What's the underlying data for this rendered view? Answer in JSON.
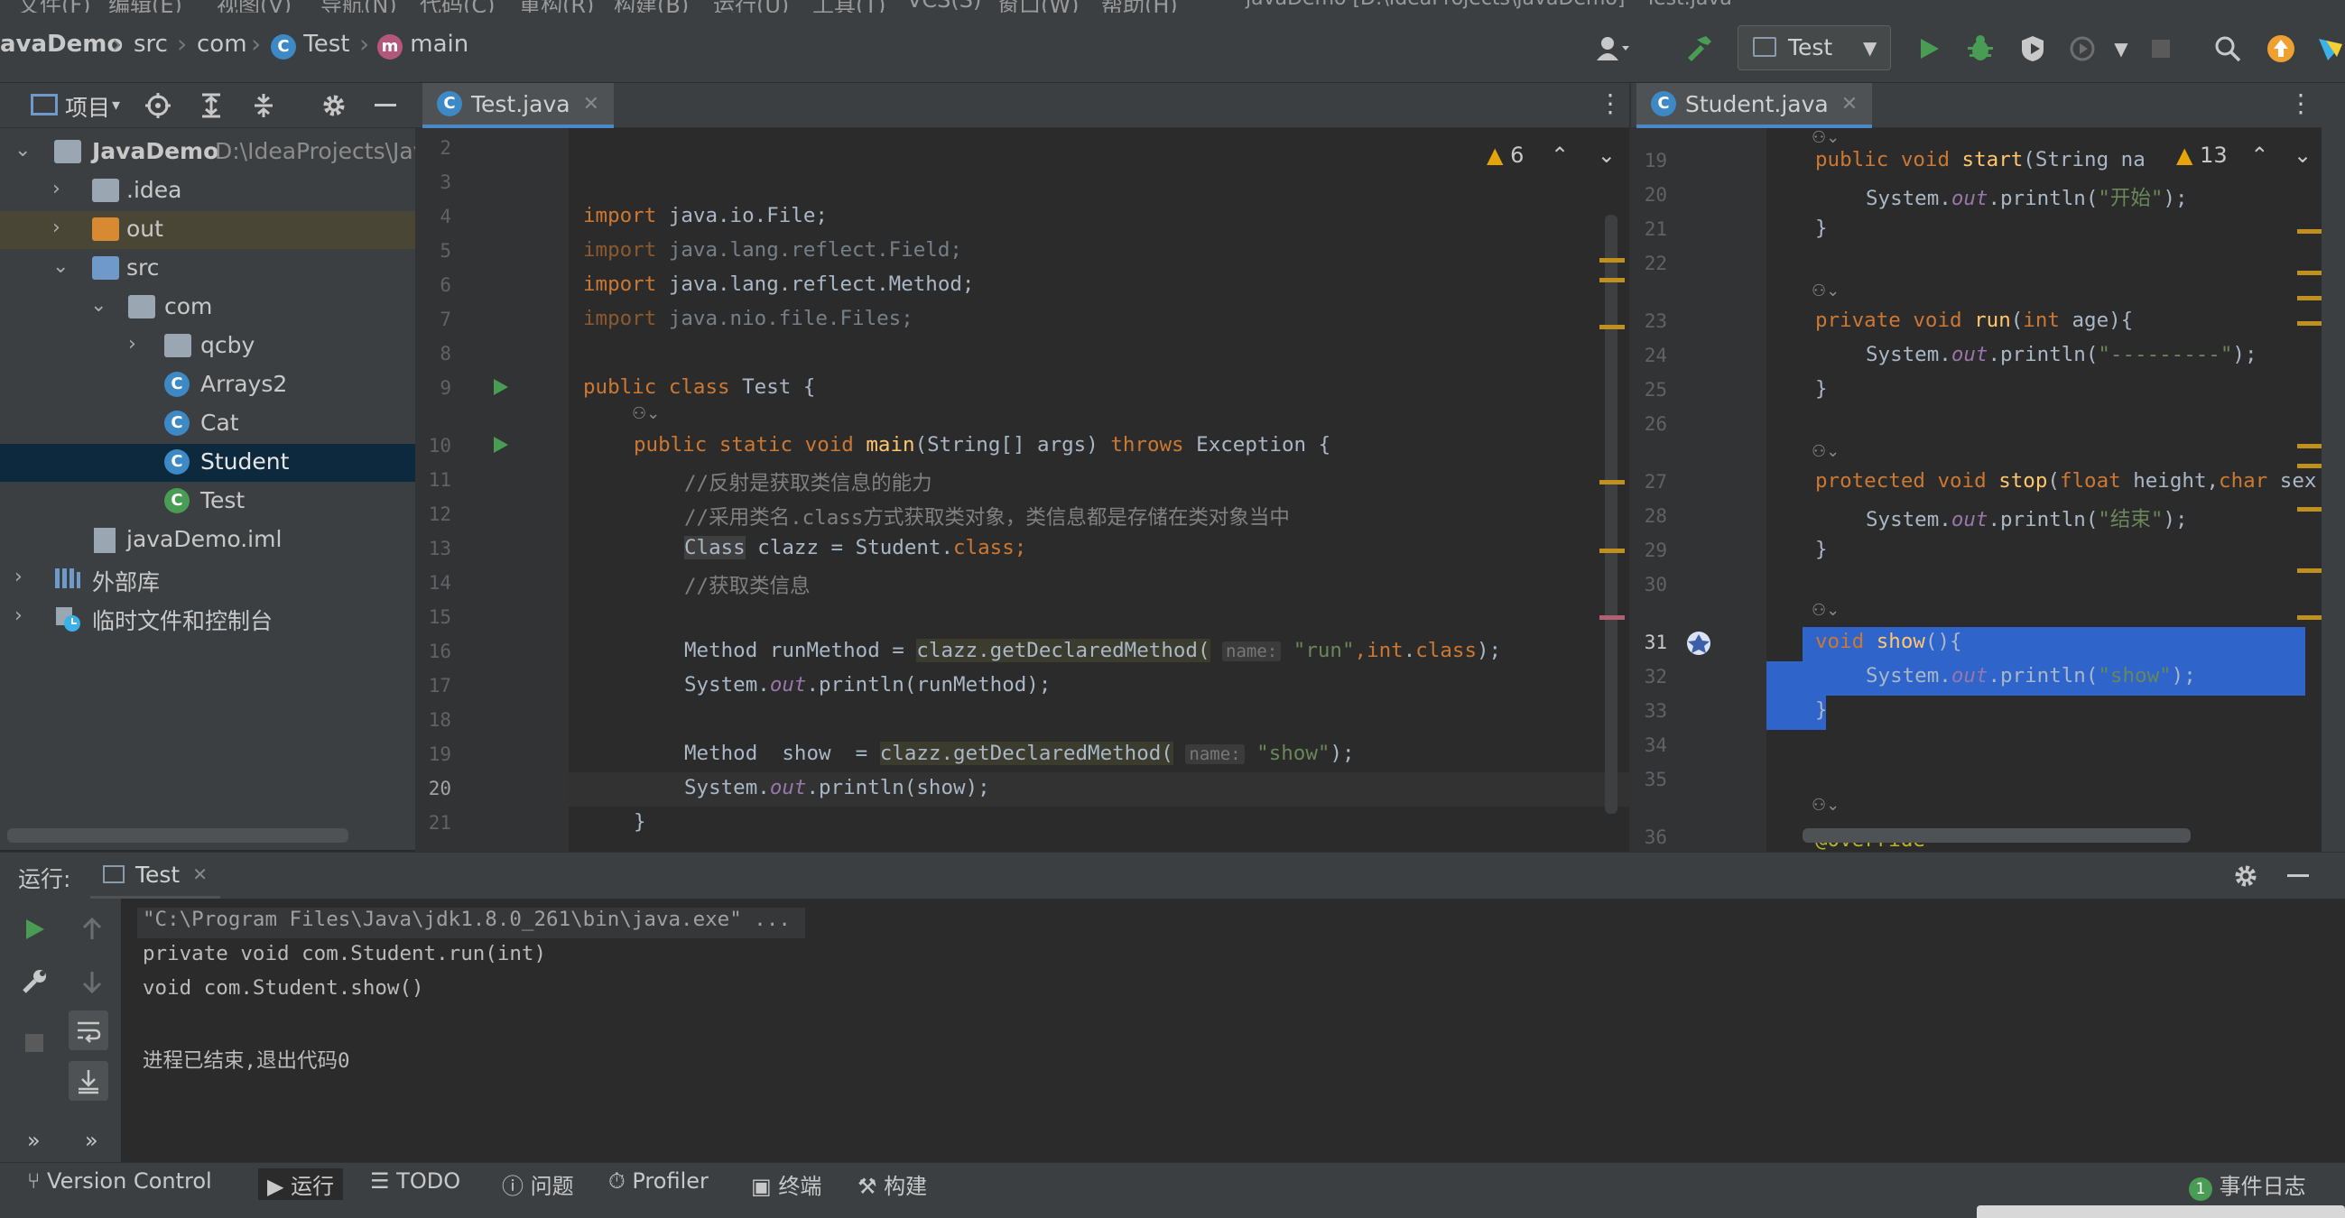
{
  "menubar": {
    "items": [
      "文件(F)",
      "编辑(E)",
      "视图(V)",
      "导航(N)",
      "代码(C)",
      "重构(R)",
      "构建(B)",
      "运行(U)",
      "工具(T)",
      "VCS(S)",
      "窗口(W)",
      "帮助(H)"
    ],
    "window_title": "javaDemo [D:\\IdeaProjects\\javaDemo] - Test.java"
  },
  "breadcrumb": {
    "project": "avaDemo",
    "src": "src",
    "com": "com",
    "class": "Test",
    "method": "main"
  },
  "toolbar": {
    "run_config": "Test"
  },
  "project_panel": {
    "title": "项目",
    "tree": [
      {
        "label": "JavaDemo",
        "path": "D:\\IdeaProjects\\Java"
      },
      {
        "label": ".idea"
      },
      {
        "label": "out"
      },
      {
        "label": "src"
      },
      {
        "label": "com"
      },
      {
        "label": "qcby"
      },
      {
        "label": "Arrays2"
      },
      {
        "label": "Cat"
      },
      {
        "label": "Student"
      },
      {
        "label": "Test"
      },
      {
        "label": "javaDemo.iml"
      },
      {
        "label": "外部库"
      },
      {
        "label": "临时文件和控制台"
      }
    ]
  },
  "left_editor": {
    "tab": "Test.java",
    "warnings": "6",
    "line_numbers": [
      "2",
      "3",
      "4",
      "5",
      "6",
      "7",
      "8",
      "9",
      "10",
      "11",
      "12",
      "13",
      "14",
      "15",
      "16",
      "17",
      "18",
      "19",
      "20",
      "21"
    ],
    "code": {
      "l4_kw": "import",
      "l4_rest": " java.io.File;",
      "l5_kw": "import",
      "l5_rest": " java.lang.reflect.Field;",
      "l6_kw": "import",
      "l6_rest": " java.lang.reflect.Method;",
      "l7_kw": "import",
      "l7_rest": " java.nio.file.Files;",
      "l9_kw": "public class",
      "l9_rest": " Test {",
      "l10_kw": "public static void",
      "l10_fn": " main",
      "l10_rest": "(String[] args) ",
      "l10_kw2": "throws",
      "l10_rest2": " Exception {",
      "l11": "//反射是获取类信息的能力",
      "l12": "//采用类名.class方式获取类对象，类信息都是存储在类对象当中",
      "l13_a": "Class",
      "l13_b": " clazz = Student.",
      "l13_kw": "class",
      "l13_c": ";",
      "l14": "//获取类信息",
      "l16_a": "Method runMethod = ",
      "l16_b": "clazz.getDeclaredMethod(",
      "l16_hint": "name:",
      "l16_str": " \"run\"",
      "l16_c": ",",
      "l16_kw": "int",
      "l16_d": ".",
      "l16_kw2": "class",
      "l16_e": ");",
      "l17_a": "System.",
      "l17_fld": "out",
      "l17_b": ".println(runMethod);",
      "l19_a": "Method  show  = ",
      "l19_b": "clazz.getDeclaredMethod(",
      "l19_hint": "name:",
      "l19_str": " \"show\"",
      "l19_c": ");",
      "l20_a": "System.",
      "l20_fld": "out",
      "l20_b": ".println(show);",
      "l21": "}"
    }
  },
  "right_editor": {
    "tab": "Student.java",
    "warnings": "13",
    "line_numbers": [
      "19",
      "20",
      "21",
      "22",
      "23",
      "24",
      "25",
      "26",
      "27",
      "28",
      "29",
      "30",
      "31",
      "32",
      "33",
      "34",
      "35",
      "36"
    ],
    "code": {
      "l19_kw": "public void",
      "l19_fn": " start",
      "l19_rest": "(String na",
      "l20_a": "System.",
      "l20_fld": "out",
      "l20_b": ".println(",
      "l20_str": "\"开始\"",
      "l20_c": ");",
      "l21": "}",
      "l23_kw": "private void",
      "l23_fn": " run",
      "l23_rest": "(",
      "l23_kw2": "int",
      "l23_rest2": " age){",
      "l24_a": "System.",
      "l24_fld": "out",
      "l24_b": ".println(",
      "l24_str": "\"---------\"",
      "l24_c": ");",
      "l25": "}",
      "l27_kw": "protected void",
      "l27_fn": " stop",
      "l27_rest": "(",
      "l27_kw2": "float",
      "l27_rest2": " height,",
      "l27_kw3": "char",
      "l27_rest3": " sex",
      "l28_a": "System.",
      "l28_fld": "out",
      "l28_b": ".println(",
      "l28_str": "\"结束\"",
      "l28_c": ");",
      "l29": "}",
      "l31_kw": "void",
      "l31_fn": " show",
      "l31_rest": "(){",
      "l32_a": "System.",
      "l32_fld": "out",
      "l32_b": ".println(",
      "l32_str": "\"show\"",
      "l32_c": ");",
      "l33": "}",
      "l36": "@Override"
    }
  },
  "run_panel": {
    "label": "运行:",
    "tab": "Test",
    "console": [
      "\"C:\\Program Files\\Java\\jdk1.8.0_261\\bin\\java.exe\" ...",
      "private void com.Student.run(int)",
      "void com.Student.show()",
      "",
      "进程已结束,退出代码0"
    ]
  },
  "bottom_bar": {
    "version_control": "Version Control",
    "run": "运行",
    "todo": "TODO",
    "problems": "问题",
    "profiler": "Profiler",
    "terminal": "终端",
    "build": "构建",
    "event_log": "事件日志",
    "event_count": "1"
  },
  "colors": {
    "accent": "#4a88c7",
    "selection": "#2f65ca",
    "warning": "#e5a40a",
    "run_green": "#499c54"
  }
}
